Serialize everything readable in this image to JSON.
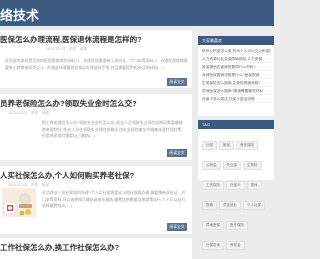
{
  "header": {
    "title": "络技术"
  },
  "articles": [
    {
      "title": "医保怎么办理流程,医保退休流程是怎样的?",
      "meta": "2023-01-03 · 浏览 · 阅读",
      "excerpt": "医保退休流程是怎样的医保需要哪些材料?1、办理医保需要带上身份证、户口本等资料;2、办理医保转移需要带上转移接续凭证;3、办理退休需要到社保局办理退休手续,并且需要提供相关证明材料(…)",
      "more": "阅读全文"
    },
    {
      "title": "员养老保险怎么办?领取失业金时怎么交?",
      "meta": "2023-01-03 · 浏览 · 阅读",
      "excerpt": "职工养老保险怎么办?领取失业金时怎么交?失业人员领取失业保险金期间需要缴纳养老保险吗?失业人员在领取失业保险金期间,由失业保险基金代缴基本医疗保险费,但是养老保险需要自己缴纳(…)",
      "more": "阅读全文"
    },
    {
      "title": "人买社保怎么办,个人如何购买养老社保?",
      "meta": "2023-01-03 · 浏览 · 阅读",
      "excerpt": "灵活就业人员社保如何办理?个人买社保需要去当地社保局办理,需要携带身份证、户口本等资料;可以选择按月缴纳或按年缴纳,缴费比例根据当地政策执行,个人可以自行选择缴费档次(…)",
      "more": "阅读全文"
    },
    {
      "title": "工作社保怎么办,换工作社保怎么办?"
    }
  ],
  "sidebar": {
    "popular_title": "大家最喜欢",
    "popular_items": [
      "杭州公积金怎么查,杭州个人可以交公积金吗",
      "人力资源与社会保障局网站,人力资源",
      "医保报销去省医院要带什么材料?",
      "深圳医保报销流程是什么?医保报销",
      "生育保险怎么报销,生育险报销流程?",
      "异地医保怎么报销?报销需要哪些材料",
      "社保卡怎么激活,社保卡激活流程"
    ],
    "tags_title": "TAG",
    "tags": [
      "社保",
      "医保",
      "养老保险",
      "公积金",
      "失业金",
      "生育险",
      "工伤保险",
      "社保卡",
      "退休",
      "报销",
      "灵活就业",
      "个人社保",
      "异地医保",
      "医疗保险",
      "社保查询",
      "养老金"
    ]
  }
}
